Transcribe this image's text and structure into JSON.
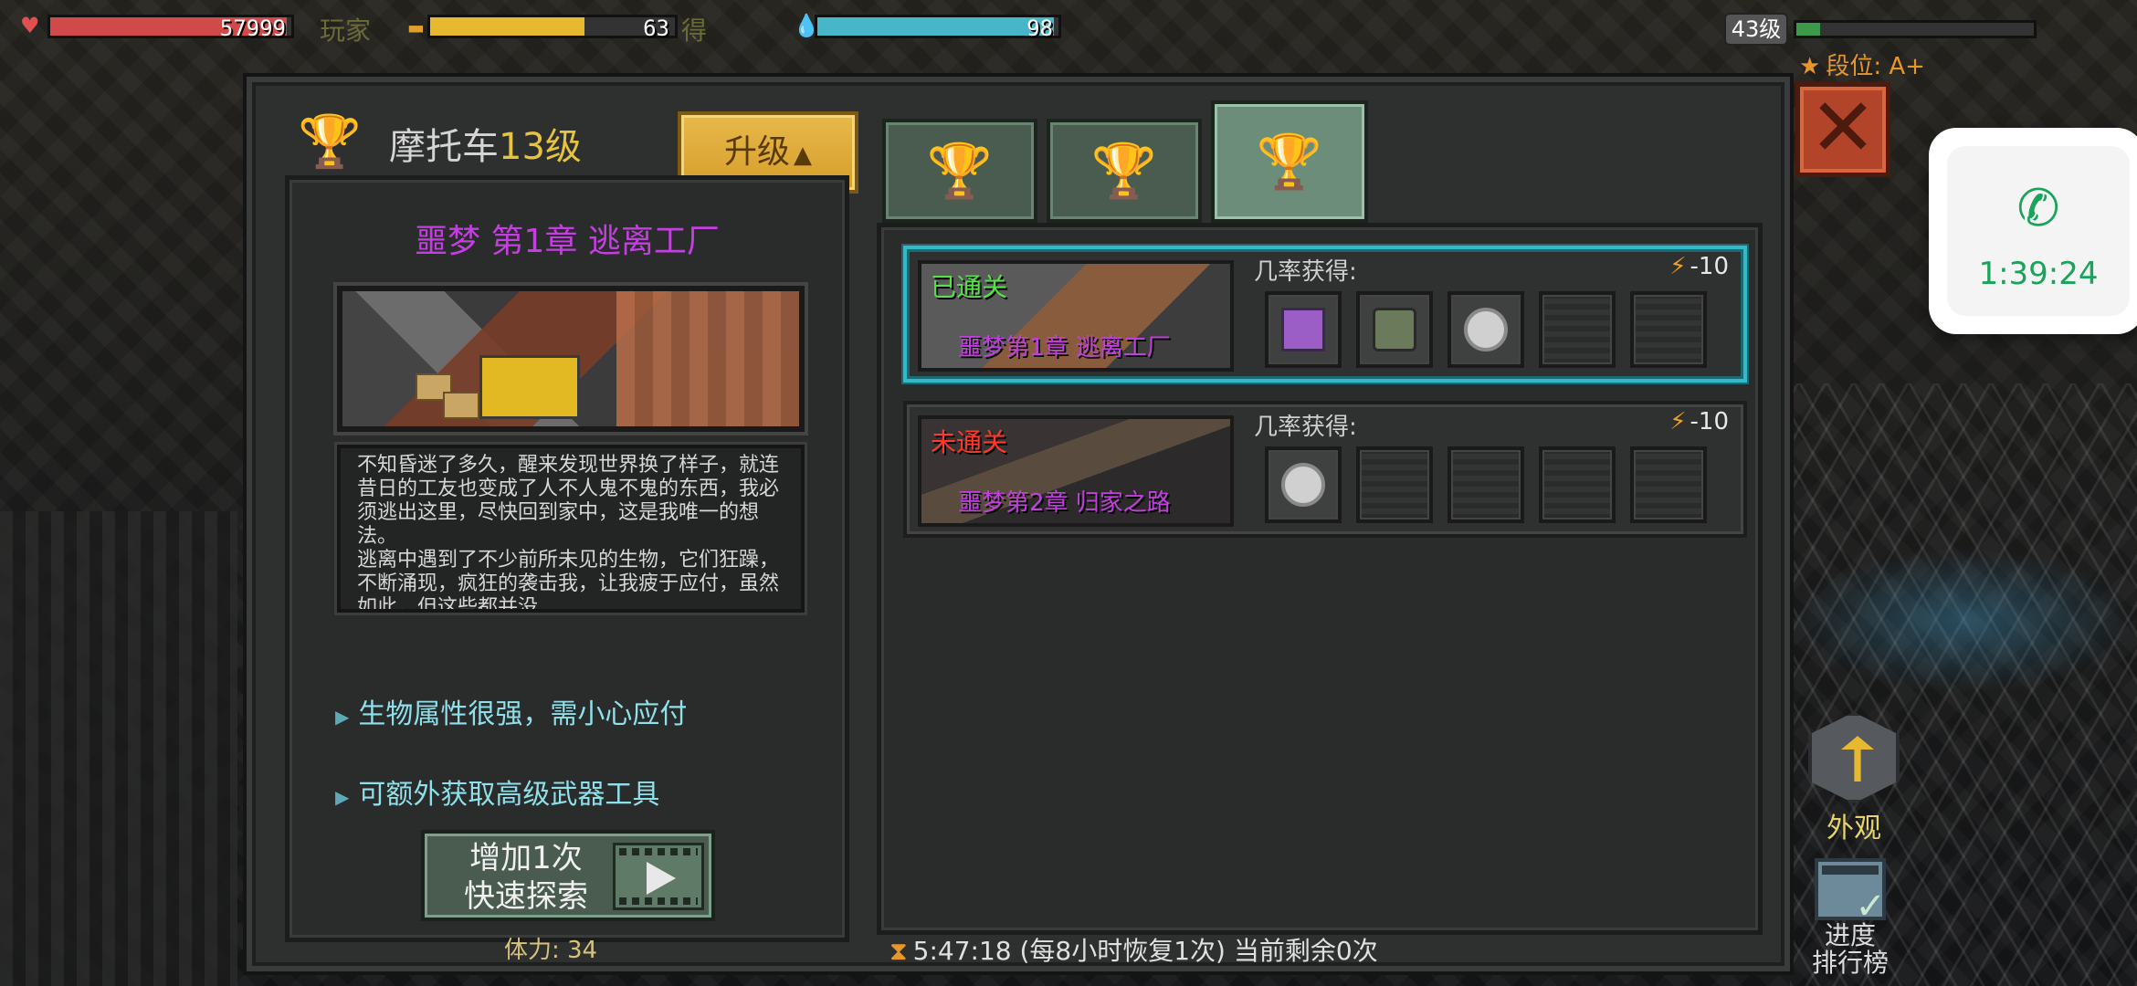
{
  "hud": {
    "hp_value": "57999",
    "hp_fill": 0.98,
    "player_label": "玩家",
    "food_value": "63",
    "food_fill": 0.63,
    "got_label": "得",
    "water_value": "98",
    "water_fill": 0.98,
    "level": "43级",
    "xp_fill": 0.1,
    "rank": "段位: A+"
  },
  "dialog": {
    "title_prefix": "摩托车",
    "title_level": "13级",
    "upgrade_label": "升级",
    "upgrade_arrow": "▲",
    "close_label": "✕"
  },
  "left": {
    "stage_title": "噩梦 第1章 逃离工厂",
    "description": "不知昏迷了多久，醒来发现世界换了样子，就连昔日的工友也变成了人不人鬼不鬼的东西，我必须逃出这里，尽快回到家中，这是我唯一的想法。\n逃离中遇到了不少前所未见的生物，它们狂躁，不断涌现，疯狂的袭击我，让我疲于应付，虽然如此，但这些都并没",
    "features": [
      "生物属性很强，需小心应付",
      "可额外获取高级武器工具"
    ],
    "quick_explore": "增加1次\n快速探索",
    "stamina": "体力: 34"
  },
  "tabs": [
    {
      "icon": "trophy-icon",
      "glyph": "🏆"
    },
    {
      "icon": "winged-trophy-icon",
      "glyph": "🏆"
    },
    {
      "icon": "winged-trophy-large-icon",
      "glyph": "🏆"
    }
  ],
  "stages": [
    {
      "status": "已通关",
      "status_type": "cleared",
      "name": "噩梦第1章 逃离工厂",
      "chance_label": "几率获得:",
      "cost": "-10",
      "slots": [
        "chest",
        "parts",
        "coin",
        "",
        ""
      ]
    },
    {
      "status": "未通关",
      "status_type": "uncleared",
      "name": "噩梦第2章 归家之路",
      "chance_label": "几率获得:",
      "cost": "-10",
      "slots": [
        "coin",
        "",
        "",
        "",
        ""
      ]
    }
  ],
  "timer": "5:47:18 (每8小时恢复1次) 当前剩余0次",
  "side": {
    "appearance_label": "外观",
    "progress_rank_label": "进度\n排行榜"
  },
  "call": {
    "time": "1:39:24"
  },
  "colors": {
    "hp": "#d14a4a",
    "food": "#e6b931",
    "water": "#47b6c8",
    "stage_title": "#c43fe0",
    "cleared": "#56e04a",
    "uncleared": "#ff3a2a",
    "call_green": "#1aa35b"
  }
}
